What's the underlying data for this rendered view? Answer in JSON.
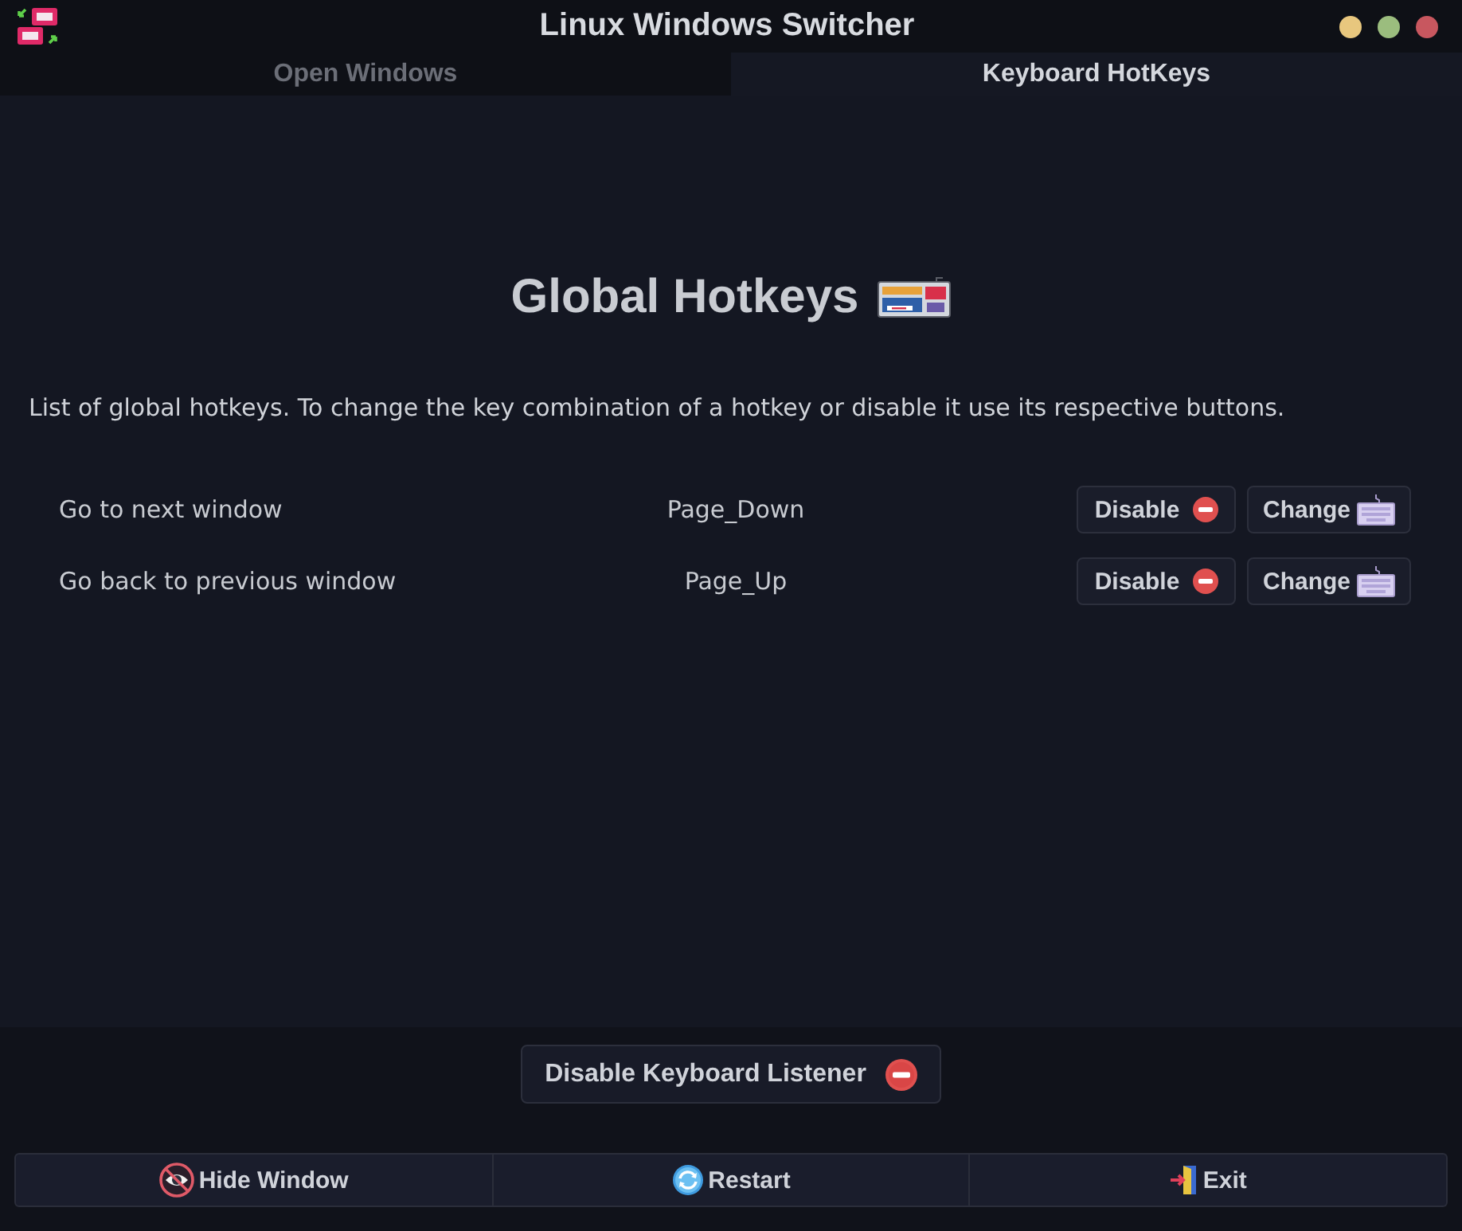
{
  "window": {
    "title": "Linux Windows Switcher"
  },
  "tabs": [
    {
      "label": "Open Windows",
      "selected": false
    },
    {
      "label": "Keyboard HotKeys",
      "selected": true
    }
  ],
  "heading": "Global Hotkeys",
  "description": "List of global hotkeys. To change the key combination of a hotkey or disable it use its respective buttons.",
  "hotkeys": [
    {
      "action": "Go to next window",
      "key": "Page_Down",
      "buttons": [
        {
          "label": "Disable",
          "kind": "disable"
        },
        {
          "label": "Change",
          "kind": "change"
        }
      ]
    },
    {
      "action": "Go back to previous window",
      "key": "Page_Up",
      "buttons": [
        {
          "label": "Disable",
          "kind": "disable"
        },
        {
          "label": "Change",
          "kind": "change"
        }
      ]
    }
  ],
  "listener_button": {
    "label": "Disable Keyboard Listener",
    "kind": "disable"
  },
  "footer_buttons": [
    {
      "label": "Hide Window",
      "kind": "hide"
    },
    {
      "label": "Restart",
      "kind": "restart"
    },
    {
      "label": "Exit",
      "kind": "exit"
    }
  ]
}
